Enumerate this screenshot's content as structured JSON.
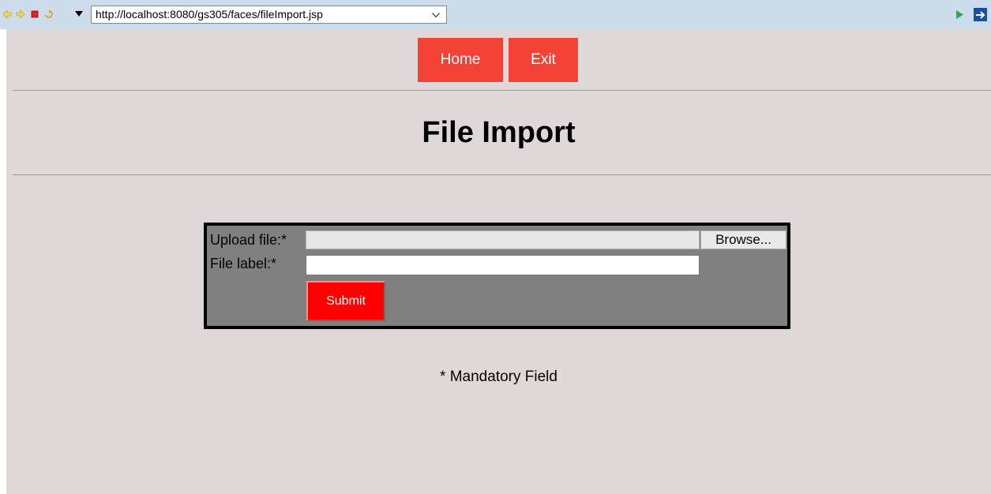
{
  "browser": {
    "url": "http://localhost:8080/gs305/faces/fileImport.jsp",
    "icons": [
      "back-arrow-icon",
      "forward-arrow-icon",
      "stop-icon",
      "refresh-icon",
      "menu-dropdown-icon",
      "url-dropdown-icon",
      "go-icon",
      "eclipse-icon"
    ]
  },
  "nav": {
    "home_label": "Home",
    "exit_label": "Exit"
  },
  "page": {
    "title": "File Import"
  },
  "form": {
    "upload_label": "Upload file:*",
    "browse_label": "Browse...",
    "file_label": "File label:*",
    "file_label_value": "",
    "submit_label": "Submit"
  },
  "footer": {
    "mandatory_note": "* Mandatory Field"
  },
  "colors": {
    "nav_button": "#f44336",
    "submit_button": "#ff0000",
    "page_background": "#e0d8d8",
    "form_background": "#808080"
  }
}
